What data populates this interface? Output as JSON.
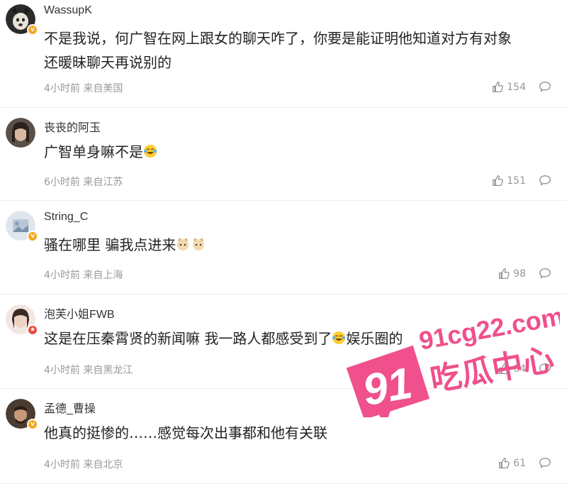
{
  "comments": [
    {
      "user": "WassupK",
      "text": "不是我说，何广智在网上跟女的聊天咋了，你要是能证明他知道对方有对象还暖昧聊天再说别的",
      "line1": "不是我说，何广智在网上跟女的聊天咋了，你要是能证明他知道对方有对象",
      "line2": "还暖昧聊天再说别的",
      "time": "4小时前",
      "source": "来自美国",
      "likes": "154",
      "badge": "gold"
    },
    {
      "user": "丧丧的阿玉",
      "text": "广智单身嘛不是",
      "time": "6小时前",
      "source": "来自江苏",
      "likes": "151",
      "badge": "none"
    },
    {
      "user": "String_C",
      "text": "骚在哪里 骗我点进来",
      "time": "4小时前",
      "source": "来自上海",
      "likes": "98",
      "badge": "gold"
    },
    {
      "user": "泡芙小姐FWB",
      "text": "这是在压秦霄贤的新闻嘛 我一路人都感受到了",
      "text_tail": "娱乐圈的",
      "time": "4小时前",
      "source": "来自黑龙江",
      "likes": "64",
      "badge": "red"
    },
    {
      "user": "孟德_曹操",
      "text": "他真的挺惨的……感觉每次出事都和他有关联",
      "time": "4小时前",
      "source": "来自北京",
      "likes": "61",
      "badge": "gold"
    }
  ],
  "watermark": {
    "number": "91",
    "site": "91cg22.com",
    "name": "吃瓜中心"
  },
  "colors": {
    "watermark": "#f0508c",
    "meta": "#999999",
    "divider": "#ececec"
  }
}
